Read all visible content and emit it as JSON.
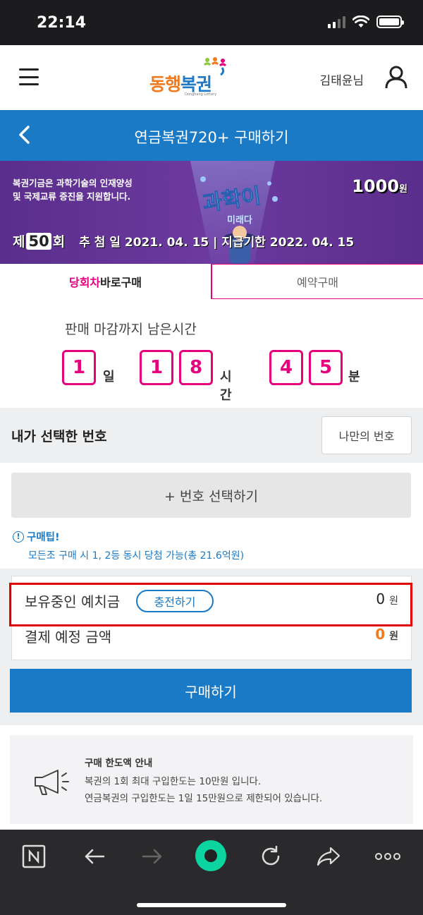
{
  "status_bar": {
    "time": "22:14"
  },
  "header": {
    "logo_text_a": "동행",
    "logo_text_b": "복권",
    "logo_sub": "Donghang Lottery",
    "username": "김태윤님"
  },
  "title_bar": {
    "title": "연금복권720+ 구매하기"
  },
  "banner": {
    "desc_line1": "복권기금은 과학기술의 인재양성",
    "desc_line2": "및 국제교류 증진을 지원합니다.",
    "price": "1000",
    "price_unit": "원",
    "round_prefix": "제",
    "round_number": "50",
    "round_suffix": "회",
    "draw_info": "추 첨 일 2021. 04. 15 | 지급기한 2022. 04. 15"
  },
  "tabs": {
    "current_highlight": "당회차",
    "current_rest": " 바로구매",
    "reserve": "예약구매"
  },
  "countdown": {
    "label": "판매 마감까지 남은시간",
    "day_digit": "1",
    "day_unit": "일",
    "hour_digit1": "1",
    "hour_digit2": "8",
    "hour_unit": "시간",
    "min_digit1": "4",
    "min_digit2": "5",
    "min_unit": "분"
  },
  "my_numbers": {
    "heading": "내가 선택한 번호",
    "mine_button": "나만의 번호",
    "select_button": "+ 번호 선택하기"
  },
  "tip": {
    "title": "구매팁!",
    "body": "모든조 구매 시 1, 2등 동시 당첨 가능(총 21.6억원)"
  },
  "payment": {
    "deposit_label": "보유중인 예치금",
    "charge_button": "충전하기",
    "deposit_amount": "0",
    "due_label": "결제 예정 금액",
    "due_amount": "0",
    "currency": "원",
    "buy_button": "구매하기"
  },
  "notice": {
    "title": "구매 한도액 안내",
    "line1": "복권의 1회 최대 구입한도는 10만원 입니다.",
    "line2": "연금복권의 구입한도는 1일 15만원으로 제한되어 있습니다."
  },
  "colors": {
    "brand_blue": "#1a7ac6",
    "accent_pink": "#e6007e",
    "amount_orange": "#f07a1e",
    "highlight_red": "#e00000"
  }
}
